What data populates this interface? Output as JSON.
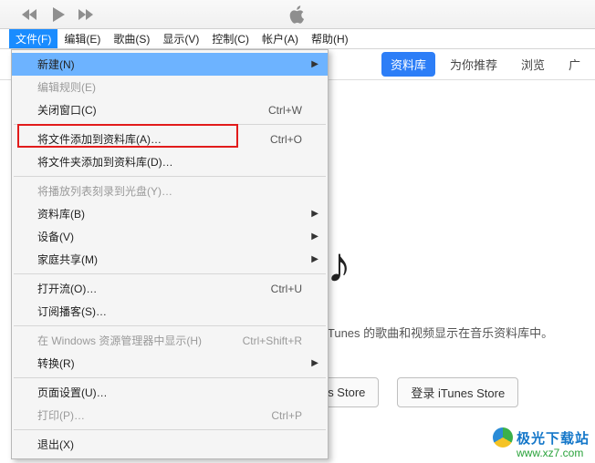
{
  "menubar": {
    "items": [
      {
        "label": "文件(F)"
      },
      {
        "label": "编辑(E)"
      },
      {
        "label": "歌曲(S)"
      },
      {
        "label": "显示(V)"
      },
      {
        "label": "控制(C)"
      },
      {
        "label": "帐户(A)"
      },
      {
        "label": "帮助(H)"
      }
    ]
  },
  "tabs": {
    "library": "资料库",
    "for_you": "为你推荐",
    "browse": "浏览",
    "radio": "广"
  },
  "file_menu": {
    "new": "新建(N)",
    "edit_rules": "编辑规则(E)",
    "close_window": "关闭窗口(C)",
    "close_window_sc": "Ctrl+W",
    "add_file": "将文件添加到资料库(A)…",
    "add_file_sc": "Ctrl+O",
    "add_folder": "将文件夹添加到资料库(D)…",
    "burn": "将播放列表刻录到光盘(Y)…",
    "library": "资料库(B)",
    "devices": "设备(V)",
    "home_sharing": "家庭共享(M)",
    "open_stream": "打开流(O)…",
    "open_stream_sc": "Ctrl+U",
    "subscribe": "订阅播客(S)…",
    "show_in_explorer": "在 Windows 资源管理器中显示(H)",
    "show_in_explorer_sc": "Ctrl+Shift+R",
    "convert": "转换(R)",
    "page_setup": "页面设置(U)…",
    "print": "打印(P)…",
    "print_sc": "Ctrl+P",
    "exit": "退出(X)"
  },
  "main": {
    "hint": "iTunes 的歌曲和视频显示在音乐资料库中。",
    "go_store": "itunes Store",
    "sign_in": "登录 iTunes Store",
    "note": "♪"
  },
  "watermark": {
    "name": "极光下载站",
    "url": "www.xz7.com"
  }
}
